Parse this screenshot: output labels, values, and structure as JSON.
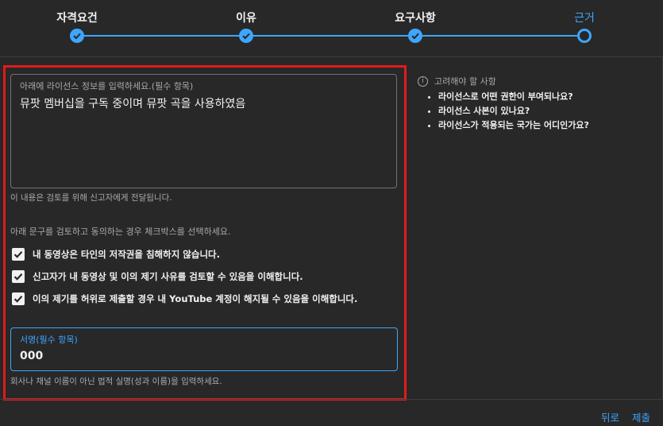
{
  "stepper": {
    "steps": [
      {
        "label": "자격요건",
        "state": "done"
      },
      {
        "label": "이유",
        "state": "done"
      },
      {
        "label": "요구사항",
        "state": "done"
      },
      {
        "label": "근거",
        "state": "current"
      }
    ]
  },
  "form": {
    "license_field": {
      "label": "아래에 라이선스 정보를 입력하세요.(필수 항목)",
      "value": "뮤팟 멤버십을 구독 중이며 뮤팟 곡을 사용하였음"
    },
    "license_helper": "이 내용은 검토를 위해 신고자에게 전달됩니다.",
    "consent_intro": "아래 문구를 검토하고 동의하는 경우 체크박스를 선택하세요.",
    "consents": [
      {
        "label": "내 동영상은 타인의 저작권을 침해하지 않습니다.",
        "checked": true
      },
      {
        "label": "신고자가 내 동영상 및 이의 제기 사유를 검토할 수 있음을 이해합니다.",
        "checked": true
      },
      {
        "label": "이의 제기를 허위로 제출할 경우 내 YouTube 계정이 해지될 수 있음을 이해합니다.",
        "checked": true
      }
    ],
    "signature_field": {
      "label": "서명(필수 항목)",
      "value": "000"
    },
    "signature_helper": "회사나 채널 이름이 아닌 법적 실명(성과 이름)을 입력하세요."
  },
  "tips": {
    "title": "고려해야 할 사항",
    "items": [
      "라이선스로 어떤 권한이 부여되나요?",
      "라이선스 사본이 있나요?",
      "라이선스가 적용되는 국가는 어디인가요?"
    ]
  },
  "footer": {
    "back_label": "뒤로",
    "submit_label": "제출"
  },
  "colors": {
    "accent": "#3ea6ff",
    "highlight_border": "#e01b1b",
    "background": "#282828"
  }
}
